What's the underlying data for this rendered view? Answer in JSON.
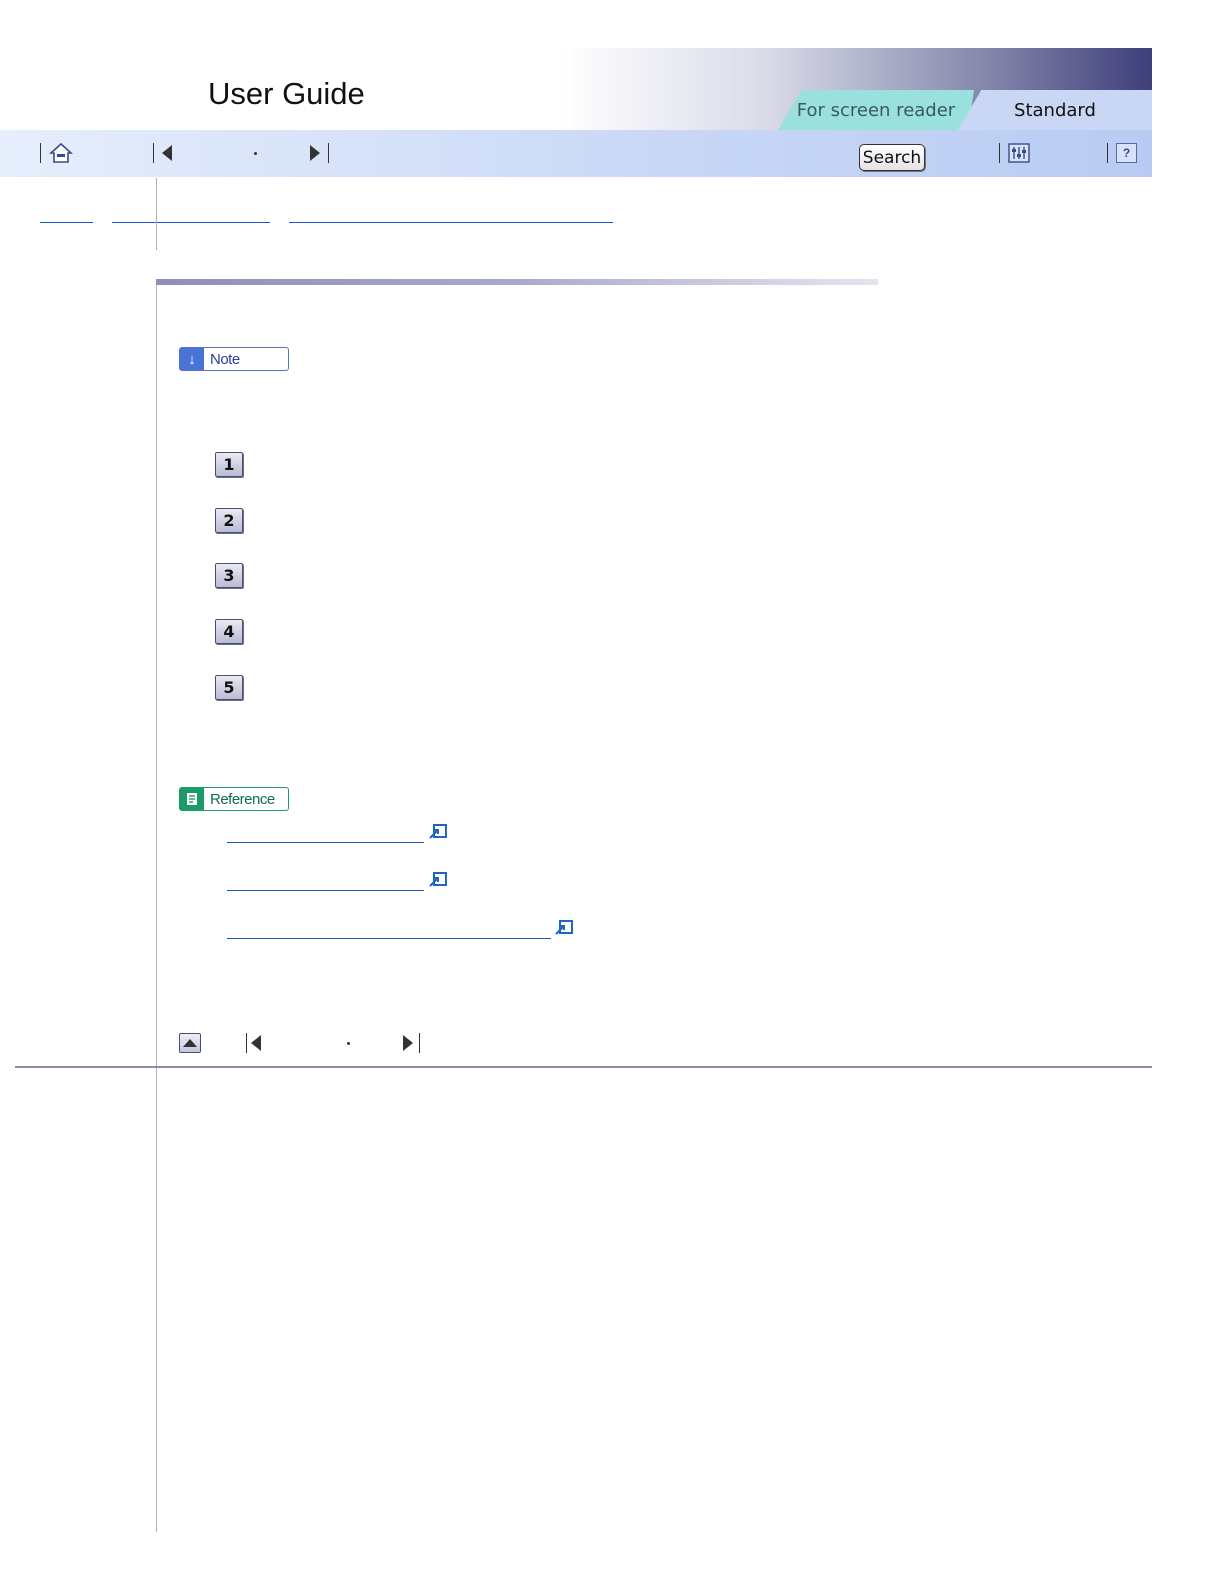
{
  "header": {
    "app_title": "User Guide",
    "tabs": [
      {
        "label": "For screen reader",
        "active": false
      },
      {
        "label": "Standard",
        "active": true
      }
    ]
  },
  "toolbar": {
    "search_label": "Search",
    "icons": [
      "home-icon",
      "previous-icon",
      "next-icon",
      "settings-icon",
      "help-icon"
    ],
    "help_glyph": "?"
  },
  "note_badge": {
    "label": "Note",
    "icon": "arrow-down-icon",
    "glyph": "↓"
  },
  "steps": [
    "1",
    "2",
    "3",
    "4",
    "5"
  ],
  "reference_badge": {
    "label": "Reference",
    "icon": "document-icon"
  },
  "colors": {
    "toolbar_bg": "#c8d7f6",
    "tab_reader": "#9ae0dc",
    "tab_standard": "#c9d6f4",
    "link": "#1a55c9",
    "note_accent": "#4a73d8",
    "reference_accent": "#1b9a6a"
  }
}
